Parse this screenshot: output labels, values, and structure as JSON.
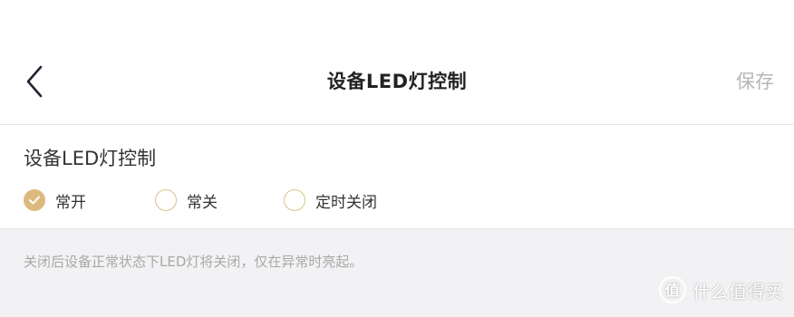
{
  "header": {
    "title": "设备LED灯控制",
    "save_label": "保存",
    "back_icon": "chevron-left-icon"
  },
  "section": {
    "title": "设备LED灯控制",
    "options": [
      {
        "label": "常开",
        "checked": true
      },
      {
        "label": "常关",
        "checked": false
      },
      {
        "label": "定时关闭",
        "checked": false
      }
    ]
  },
  "hint": "关闭后设备正常状态下LED灯将关闭，仅在异常时亮起。",
  "watermark": {
    "text": "什么值得买",
    "icon": "smzdm-logo-icon"
  },
  "colors": {
    "accent": "#dcba7f",
    "radio_border": "#dcc08d",
    "save_disabled": "#b6b6b6",
    "hint_text": "#a8a8a8",
    "page_background": "#f2f2f4"
  }
}
